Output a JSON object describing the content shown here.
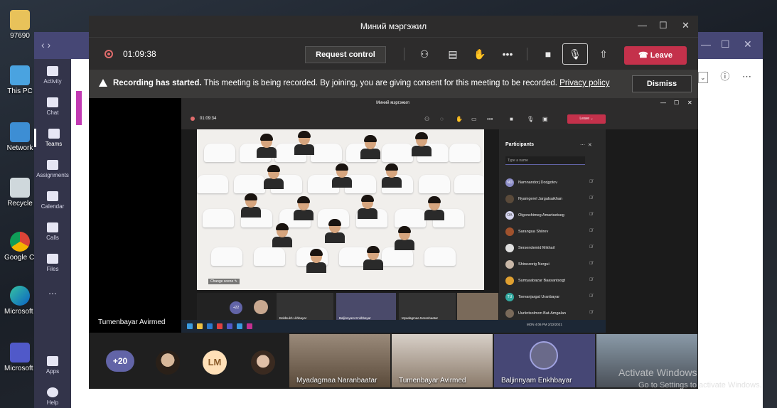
{
  "desktop": {
    "icons": [
      {
        "label": "97690"
      },
      {
        "label": "This PC"
      },
      {
        "label": "Network"
      },
      {
        "label": "Recycle"
      },
      {
        "label": "Google Chrome"
      },
      {
        "label": "Microsoft Edge"
      },
      {
        "label": "Microsoft Teams"
      }
    ]
  },
  "teams_rail": {
    "items": [
      {
        "label": "Activity"
      },
      {
        "label": "Chat"
      },
      {
        "label": "Teams"
      },
      {
        "label": "Assignments"
      },
      {
        "label": "Calendar"
      },
      {
        "label": "Calls"
      },
      {
        "label": "Files"
      },
      {
        "label": "..."
      },
      {
        "label": "Apps"
      },
      {
        "label": "Help"
      }
    ]
  },
  "meeting": {
    "title": "Миний мэргэжил",
    "timer": "01:09:38",
    "request_control": "Request control",
    "leave": "Leave",
    "banner": {
      "bold": "Recording has started.",
      "text": "This meeting is being recorded. By joining, you are giving consent for this meeting to be recorded.",
      "link": "Privacy policy",
      "dismiss": "Dismiss"
    },
    "presenter_name": "Tumenbayar Avirmed",
    "inner": {
      "title": "Миний мэргэжил",
      "timer": "01:09:34",
      "leave": "Leave",
      "change_scene": "Change scene",
      "participants_title": "Participants",
      "search_placeholder": "Type a name",
      "participants": [
        {
          "initials": "ND",
          "name": "Namnandorj Dorjgotov"
        },
        {
          "initials": "",
          "name": "Nyamgerel Jargalsaikhan"
        },
        {
          "initials": "OA",
          "name": "Otgonchimeg Amartsetseg"
        },
        {
          "initials": "",
          "name": "Sarangua Shiirev"
        },
        {
          "initials": "",
          "name": "Sersendemid Mikhail"
        },
        {
          "initials": "",
          "name": "Shinezorig Nergui"
        },
        {
          "initials": "",
          "name": "Sumyaabazar Baasantsogt"
        },
        {
          "initials": "TU",
          "name": "Tsevanjargal Uranbayar"
        },
        {
          "initials": "",
          "name": "Uuriintsolmon Bat-Amgalan"
        }
      ],
      "strip": {
        "plus": "+22",
        "tiles": [
          "Boldsukh Lkhbayar",
          "Baljinnyam Enkhbayar",
          "Myadagmaa Naranbaatar"
        ]
      },
      "taskbar_time": "4:06 PM",
      "taskbar_date": "2/22/2021",
      "taskbar_lang": "MON"
    },
    "bottom": {
      "plus": "+20",
      "initials": "LM",
      "tiles": [
        "Myadagmaa Naranbaatar",
        "Tumenbayar Avirmed",
        "Baljinnyam Enkhbayar"
      ]
    }
  },
  "watermark": {
    "line1": "Activate Windows",
    "line2": "Go to Settings to activate Windows."
  },
  "colors": {
    "teams_purple": "#464775",
    "leave_red": "#c4314b",
    "accent": "#6264a7"
  }
}
